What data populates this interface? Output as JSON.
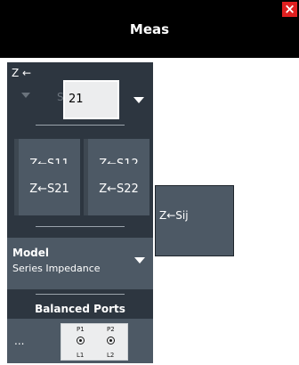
{
  "header": {
    "title": "Meas",
    "close_symbol": "×"
  },
  "panel": {
    "z_label": "Z ←",
    "s_label": "S",
    "s_value": "21",
    "buttons": [
      "Z←S11",
      "Z←S12",
      "Z←S21",
      "Z←S22"
    ],
    "popout_label": "Z←Sij",
    "model": {
      "label": "Model",
      "value": "Series Impedance"
    },
    "balanced": {
      "title": "Balanced Ports",
      "dots": "...",
      "p1": "P1",
      "p2": "P2",
      "l1": "L1",
      "l2": "L2"
    }
  },
  "colors": {
    "header_bg": "#000000",
    "panel_bg": "#2d3640",
    "button_bg": "#4d5965",
    "close_bg": "#e02020"
  }
}
